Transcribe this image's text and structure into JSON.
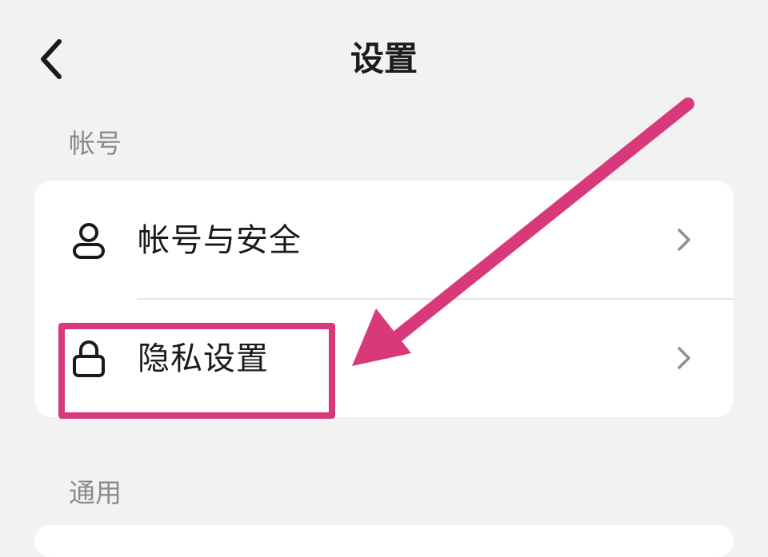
{
  "header": {
    "title": "设置",
    "back_icon": "chevron-left-icon"
  },
  "sections": {
    "account": {
      "label": "帐号",
      "items": [
        {
          "label": "帐号与安全",
          "icon": "user-icon"
        },
        {
          "label": "隐私设置",
          "icon": "lock-icon"
        }
      ]
    },
    "general": {
      "label": "通用"
    }
  },
  "annotation": {
    "highlight_color": "#d8397a",
    "target": "隐私设置"
  }
}
